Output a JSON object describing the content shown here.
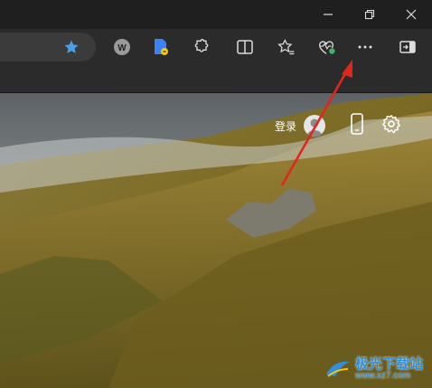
{
  "window": {
    "controls": [
      {
        "name": "minimize-button",
        "icon": "minimize-icon"
      },
      {
        "name": "restore-button",
        "icon": "restore-icon"
      },
      {
        "name": "close-button",
        "icon": "close-icon"
      }
    ]
  },
  "toolbar": {
    "favorite_star_color": "#4a9fe8",
    "buttons": [
      {
        "icon": "extension-w-icon"
      },
      {
        "icon": "read-aloud-icon"
      },
      {
        "icon": "extensions-puzzle-icon"
      },
      {
        "icon": "split-screen-icon"
      },
      {
        "icon": "favorites-icon"
      },
      {
        "icon": "browser-essentials-icon"
      },
      {
        "icon": "more-options-icon"
      },
      {
        "icon": "sidebar-toggle-icon"
      }
    ]
  },
  "page": {
    "signin_label": "登录",
    "annotation_color": "#e0261d"
  },
  "watermark": {
    "text": "极光下载站",
    "url": "www.xz7.com"
  }
}
